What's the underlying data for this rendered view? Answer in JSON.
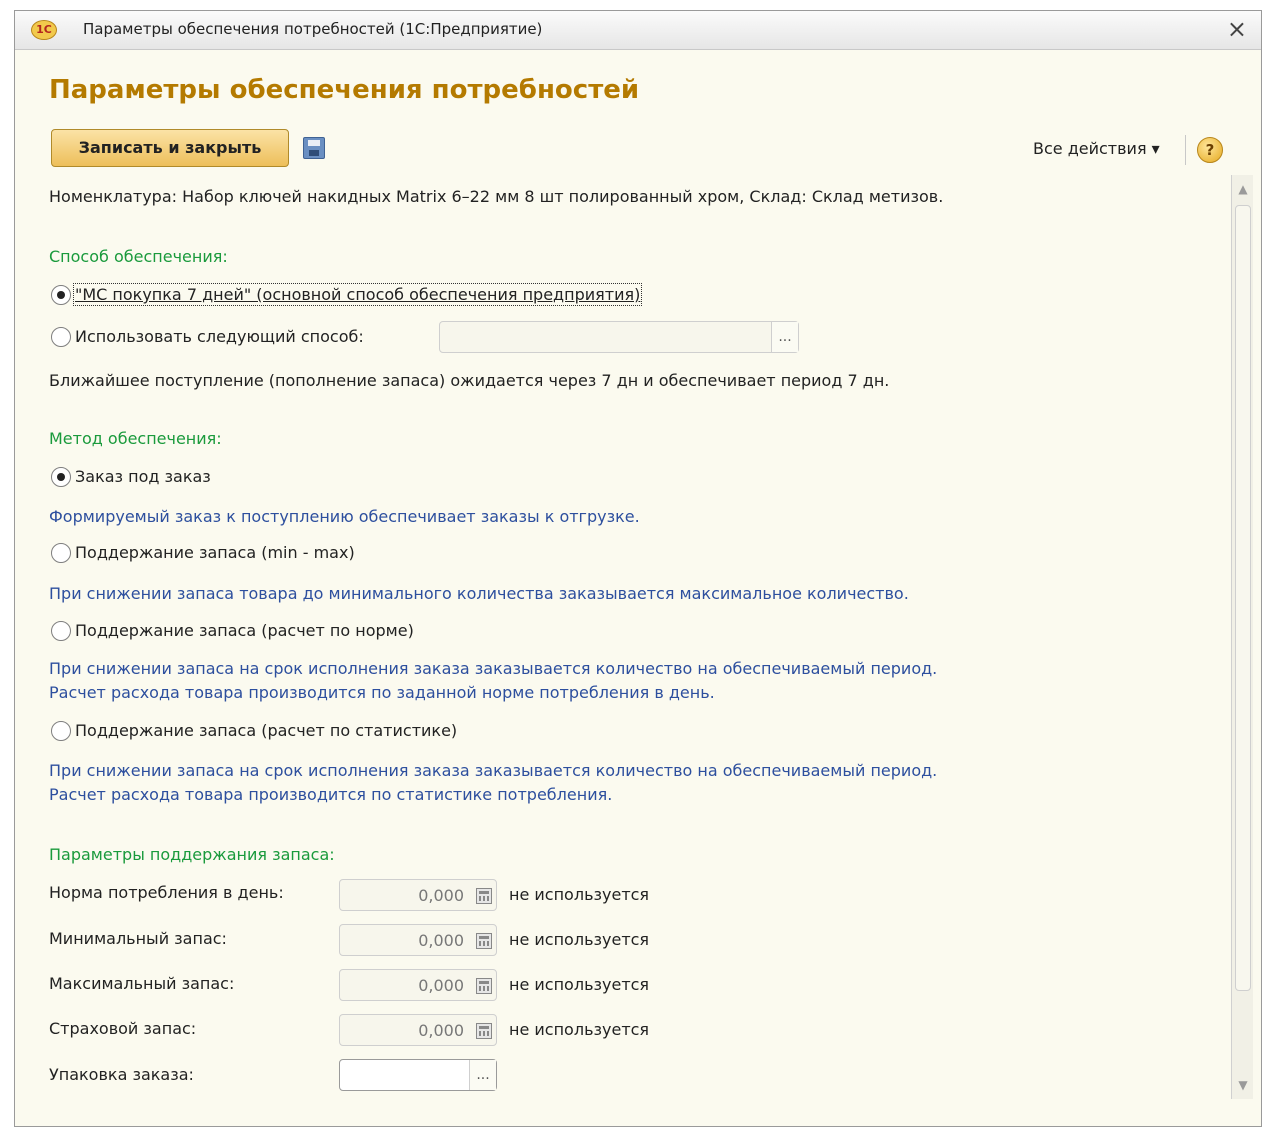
{
  "window": {
    "title": "Параметры обеспечения потребностей  (1С:Предприятие)",
    "logo": "1С",
    "close_glyph": "×"
  },
  "form": {
    "heading": "Параметры обеспечения потребностей",
    "toolbar": {
      "save_close_label": "Записать и закрыть",
      "all_actions_label": "Все действия ▾",
      "help_glyph": "?"
    },
    "item_info": "Номенклатура: Набор ключей накидных Matrix 6–22 мм 8 шт полированный хром, Склад: Склад метизов.",
    "supply_way": {
      "label": "Способ обеспечения:",
      "option_default": "\"МС покупка 7 дней\" (основной способ обеспечения предприятия)",
      "option_custom": "Использовать следующий способ:",
      "custom_value": "",
      "choose_glyph": "...",
      "next_receipt_note": "Ближайшее поступление (пополнение запаса) ожидается через 7 дн и обеспечивает период 7 дн."
    },
    "supply_method": {
      "label": "Метод обеспечения:",
      "options": [
        {
          "label": "Заказ под заказ",
          "description": "Формируемый заказ к поступлению обеспечивает заказы к отгрузке.",
          "selected": true
        },
        {
          "label": "Поддержание запаса (min - max)",
          "description": "При снижении запаса товара до минимального количества заказывается максимальное количество.",
          "selected": false
        },
        {
          "label": "Поддержание запаса (расчет по норме)",
          "description_line1": "При снижении запаса на срок исполнения заказа заказывается количество на обеспечиваемый период.",
          "description_line2": "Расчет расхода товара производится по заданной норме потребления в день.",
          "selected": false
        },
        {
          "label": "Поддержание запаса (расчет по статистике)",
          "description_line1": "При снижении запаса на срок исполнения заказа заказывается количество на обеспечиваемый период.",
          "description_line2": "Расчет расхода товара производится по статистике потребления.",
          "selected": false
        }
      ]
    },
    "stock_params": {
      "label": "Параметры поддержания запаса:",
      "fields": [
        {
          "label": "Норма потребления в день:",
          "value": "0,000",
          "note": "не используется"
        },
        {
          "label": "Минимальный запас:",
          "value": "0,000",
          "note": "не используется"
        },
        {
          "label": "Максимальный запас:",
          "value": "0,000",
          "note": "не используется"
        },
        {
          "label": "Страховой запас:",
          "value": "0,000",
          "note": "не используется"
        }
      ],
      "package_label": "Упаковка заказа:",
      "package_value": "",
      "choose_glyph": "..."
    },
    "scrollbar": {
      "up_glyph": "▲",
      "down_glyph": "▼"
    }
  }
}
